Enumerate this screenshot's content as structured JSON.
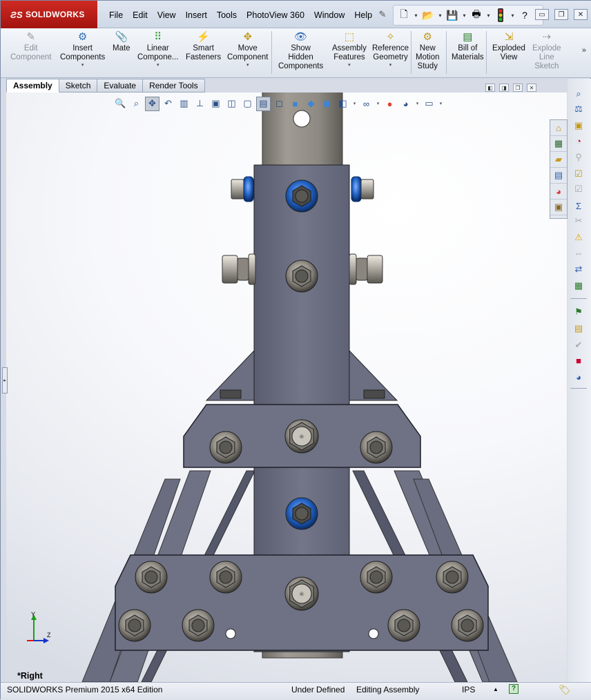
{
  "app": {
    "brand": "SOLIDWORKS",
    "menu": [
      "File",
      "Edit",
      "View",
      "Insert",
      "Tools",
      "PhotoView 360",
      "Window",
      "Help"
    ]
  },
  "quick_access": {
    "icons": [
      "new-document-icon",
      "open-folder-icon",
      "save-icon",
      "print-icon",
      "rebuild-icon",
      "help-icon"
    ]
  },
  "window_controls": {
    "minimize": "▭",
    "restore": "❐",
    "close": "✕"
  },
  "command_manager": {
    "buttons": [
      {
        "id": "edit-component",
        "lines": [
          "Edit",
          "Component"
        ],
        "disabled": true,
        "dropdown": false
      },
      {
        "id": "insert-components",
        "lines": [
          "Insert",
          "Components"
        ],
        "disabled": false,
        "dropdown": true
      },
      {
        "id": "mate",
        "lines": [
          "Mate"
        ],
        "disabled": false,
        "dropdown": false
      },
      {
        "id": "linear-component",
        "lines": [
          "Linear",
          "Compone..."
        ],
        "disabled": false,
        "dropdown": true
      },
      {
        "id": "smart-fasteners",
        "lines": [
          "Smart",
          "Fasteners"
        ],
        "disabled": false,
        "dropdown": false
      },
      {
        "id": "move-component",
        "lines": [
          "Move",
          "Component"
        ],
        "disabled": false,
        "dropdown": true
      },
      {
        "id": "show-hidden",
        "lines": [
          "Show",
          "Hidden",
          "Components"
        ],
        "disabled": false,
        "dropdown": false
      },
      {
        "id": "assembly-features",
        "lines": [
          "Assembly",
          "Features"
        ],
        "disabled": false,
        "dropdown": true
      },
      {
        "id": "reference-geometry",
        "lines": [
          "Reference",
          "Geometry"
        ],
        "disabled": false,
        "dropdown": true
      },
      {
        "id": "new-motion-study",
        "lines": [
          "New",
          "Motion",
          "Study"
        ],
        "disabled": false,
        "dropdown": false
      },
      {
        "id": "bill-of-materials",
        "lines": [
          "Bill of",
          "Materials"
        ],
        "disabled": false,
        "dropdown": false
      },
      {
        "id": "exploded-view",
        "lines": [
          "Exploded",
          "View"
        ],
        "disabled": false,
        "dropdown": false
      },
      {
        "id": "explode-line-sketch",
        "lines": [
          "Explode",
          "Line",
          "Sketch"
        ],
        "disabled": true,
        "dropdown": false
      }
    ],
    "more": "»"
  },
  "tabs": [
    "Assembly",
    "Sketch",
    "Evaluate",
    "Render Tools"
  ],
  "active_tab": "Assembly",
  "viewport": {
    "view_label": "*Right",
    "triad": {
      "y": "Y",
      "z": "Z"
    }
  },
  "status": {
    "edition": "SOLIDWORKS Premium 2015 x64 Edition",
    "state": "Under Defined",
    "mode": "Editing Assembly",
    "units": "IPS",
    "units_caret": "▲",
    "help": "?"
  },
  "colors": {
    "accent": "#c4261f",
    "steel": "#6b6e82",
    "tube": "#8e8a83",
    "blue_nut": "#1f5fbf"
  }
}
